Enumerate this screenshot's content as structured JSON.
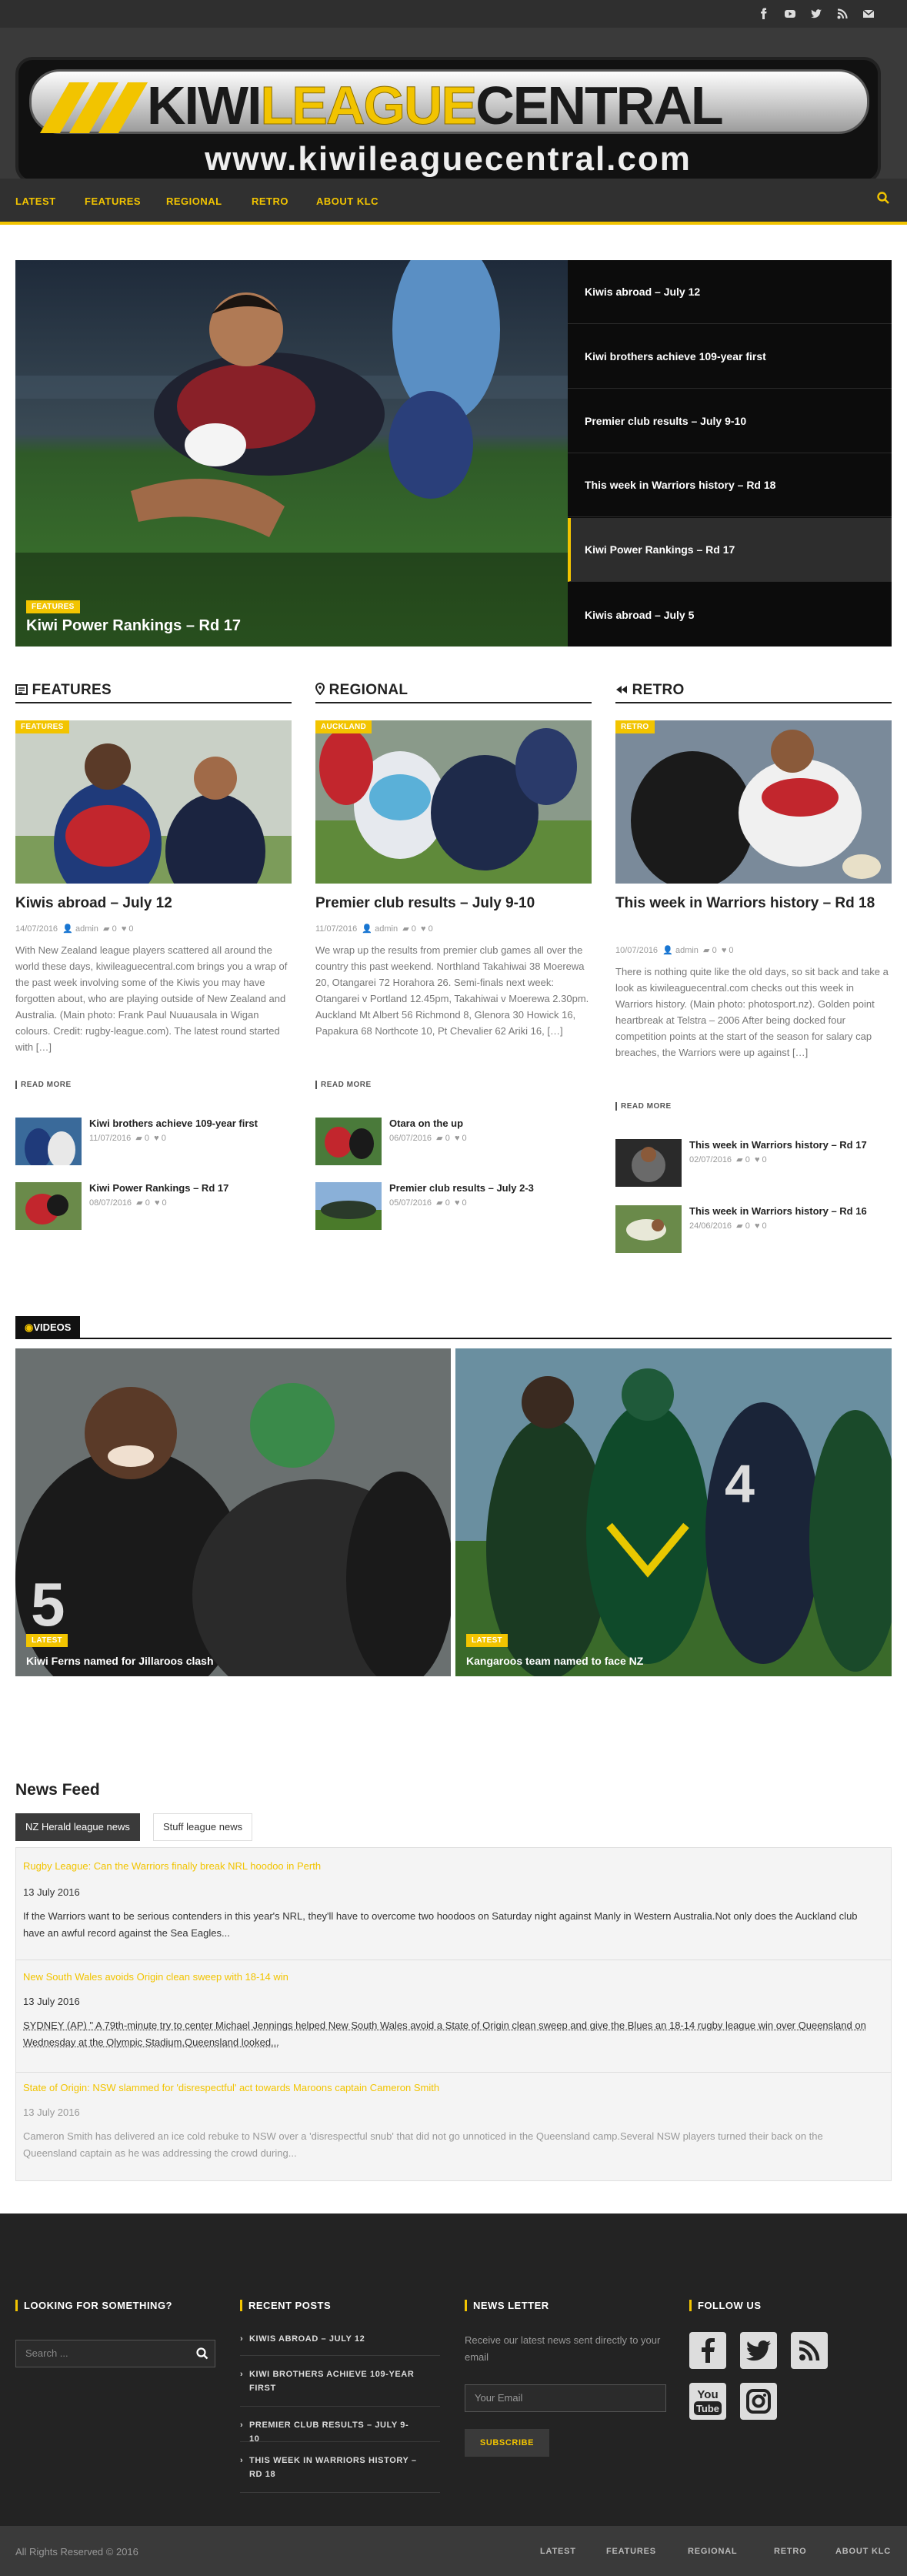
{
  "site": {
    "name_part1": "KIWI",
    "name_part2": "LEAGUE",
    "name_part3": "CENTRAL",
    "url": "www.kiwileaguecentral.com"
  },
  "topbar": {
    "icons": [
      "facebook-icon",
      "youtube-icon",
      "twitter-icon",
      "rss-icon",
      "email-icon"
    ]
  },
  "nav": {
    "items": [
      "LATEST",
      "FEATURES",
      "REGIONAL",
      "RETRO",
      "ABOUT KLC"
    ]
  },
  "slider": {
    "main": {
      "tag": "FEATURES",
      "title": "Kiwi Power Rankings – Rd 17"
    },
    "list": [
      "Kiwis abroad – July 12",
      "Kiwi brothers achieve 109-year first",
      "Premier club results – July 9-10",
      "This week in Warriors history – Rd 18",
      "Kiwi Power Rankings – Rd 17",
      "Kiwis abroad – July 5"
    ]
  },
  "columns": [
    {
      "heading": "FEATURES",
      "tag": "FEATURES",
      "title": "Kiwis abroad – July 12",
      "date": "14/07/2016",
      "author": "admin",
      "comments": "0",
      "likes": "0",
      "excerpt": "With New Zealand league players scattered all around the world these days, kiwileaguecentral.com brings you a wrap of the past week involving some of the Kiwis you may have forgotten about, who are playing outside of New Zealand and Australia. (Main photo: Frank Paul Nuuausala in Wigan colours. Credit: rugby-league.com). The latest round started with […]",
      "read_more": "READ MORE",
      "related": [
        {
          "title": "Kiwi brothers achieve 109-year first",
          "date": "11/07/2016",
          "comments": "0",
          "likes": "0"
        },
        {
          "title": "Kiwi Power Rankings – Rd 17",
          "date": "08/07/2016",
          "comments": "0",
          "likes": "0"
        }
      ]
    },
    {
      "heading": "REGIONAL",
      "tag": "AUCKLAND",
      "title": "Premier club results – July 9-10",
      "date": "11/07/2016",
      "author": "admin",
      "comments": "0",
      "likes": "0",
      "excerpt": "We wrap up the results from premier club games all over the country this past weekend. Northland Takahiwai 38 Moerewa 20, Otangarei 72 Horahora 26. Semi-finals next week: Otangarei v Portland 12.45pm, Takahiwai v Moerewa 2.30pm. Auckland Mt Albert 56 Richmond 8, Glenora 30 Howick 16, Papakura 68 Northcote 10, Pt Chevalier 62 Ariki 16, […]",
      "read_more": "READ MORE",
      "related": [
        {
          "title": "Otara on the up",
          "date": "06/07/2016",
          "comments": "0",
          "likes": "0"
        },
        {
          "title": "Premier club results – July 2-3",
          "date": "05/07/2016",
          "comments": "0",
          "likes": "0"
        }
      ]
    },
    {
      "heading": "RETRO",
      "tag": "RETRO",
      "title": "This week in Warriors history – Rd 18",
      "date": "10/07/2016",
      "author": "admin",
      "comments": "0",
      "likes": "0",
      "excerpt": "There is nothing quite like the old days, so sit back and take a look as kiwileaguecentral.com checks out this week in Warriors history. (Main photo: photosport.nz). Golden point heartbreak at Telstra – 2006 After being docked four competition points at the start of the season for salary cap breaches, the Warriors were up against […]",
      "read_more": "READ MORE",
      "related": [
        {
          "title": "This week in Warriors history – Rd 17",
          "date": "02/07/2016",
          "comments": "0",
          "likes": "0"
        },
        {
          "title": "This week in Warriors history – Rd 16",
          "date": "24/06/2016",
          "comments": "0",
          "likes": "0"
        }
      ]
    }
  ],
  "videos": {
    "heading": "VIDEOS",
    "items": [
      {
        "tag": "LATEST",
        "title": "Kiwi Ferns named for Jillaroos clash"
      },
      {
        "tag": "LATEST",
        "title": "Kangaroos team named to face NZ"
      }
    ]
  },
  "news_feed": {
    "title": "News Feed",
    "tabs": [
      "NZ Herald league news",
      "Stuff league news"
    ],
    "items": [
      {
        "headline": "Rugby League: Can the Warriors finally break NRL hoodoo in Perth",
        "date": "13 July 2016",
        "text": "If the Warriors want to be serious contenders in this year's NRL, they'll have to overcome two hoodoos on Saturday night against Manly in Western Australia.Not only does the Auckland club have an awful record against the Sea Eagles..."
      },
      {
        "headline": "New South Wales avoids Origin clean sweep with 18-14 win",
        "date": "13 July 2016",
        "text": "SYDNEY (AP) \" A 79th-minute try to center Michael Jennings helped New South Wales avoid a State of Origin clean sweep and give the Blues an 18-14 rugby league win over Queensland on Wednesday at the Olympic Stadium.Queensland looked..."
      },
      {
        "headline": "State of Origin: NSW slammed for 'disrespectful' act towards Maroons captain Cameron Smith",
        "date": "13 July 2016",
        "text": "Cameron Smith has delivered an ice cold rebuke to NSW over a 'disrespectful snub' that did not go unnoticed in the Queensland camp.Several NSW players turned their back on the Queensland captain as he was addressing the crowd during..."
      }
    ]
  },
  "footer": {
    "search_heading": "LOOKING FOR SOMETHING?",
    "search_placeholder": "Search ...",
    "recent_heading": "RECENT POSTS",
    "recent_posts": [
      "KIWIS ABROAD – JULY 12",
      "KIWI BROTHERS ACHIEVE 109-YEAR FIRST",
      "PREMIER CLUB RESULTS – JULY 9-10",
      "THIS WEEK IN WARRIORS HISTORY – RD 18"
    ],
    "newsletter_heading": "NEWS LETTER",
    "newsletter_text": "Receive our latest news sent directly to your email",
    "email_placeholder": "Your Email",
    "subscribe": "SUBSCRIBE",
    "follow_heading": "FOLLOW US",
    "follow_icons": [
      "facebook-icon",
      "twitter-icon",
      "rss-icon",
      "youtube-icon",
      "instagram-icon"
    ],
    "youtube_text_1": "You",
    "youtube_text_2": "Tube",
    "copyright": "All Rights Reserved © 2016",
    "bottom_nav": [
      "LATEST",
      "FEATURES",
      "REGIONAL",
      "RETRO",
      "ABOUT KLC"
    ]
  },
  "colors": {
    "accent": "#f2c400",
    "dark": "#232323",
    "nav": "#303030"
  }
}
